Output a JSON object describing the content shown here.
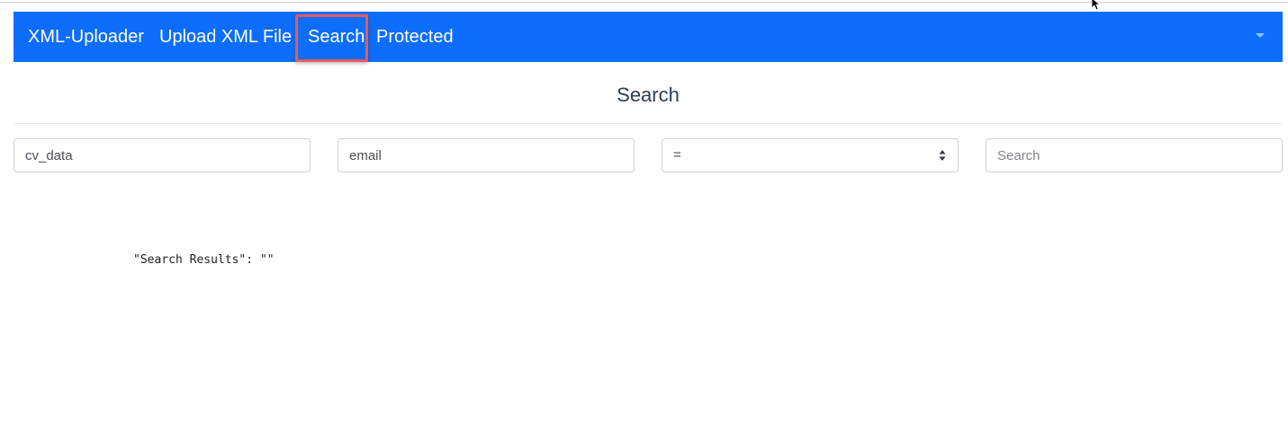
{
  "navbar": {
    "brand": "XML-Uploader",
    "links": [
      {
        "label": "Upload XML File"
      },
      {
        "label": "Search"
      },
      {
        "label": "Protected"
      }
    ],
    "background_color": "#0d6efd",
    "highlight_color": "#e8595a"
  },
  "page": {
    "title": "Search"
  },
  "search_form": {
    "collection_value": "cv_data",
    "field_value": "email",
    "operator_selected": "=",
    "query_placeholder": "Search"
  },
  "results": {
    "text": "\"Search Results\": \"\""
  },
  "icons": {
    "dropdown": "chevron-down-icon",
    "select": "select-arrows-icon",
    "cursor": "mouse-cursor-icon"
  }
}
